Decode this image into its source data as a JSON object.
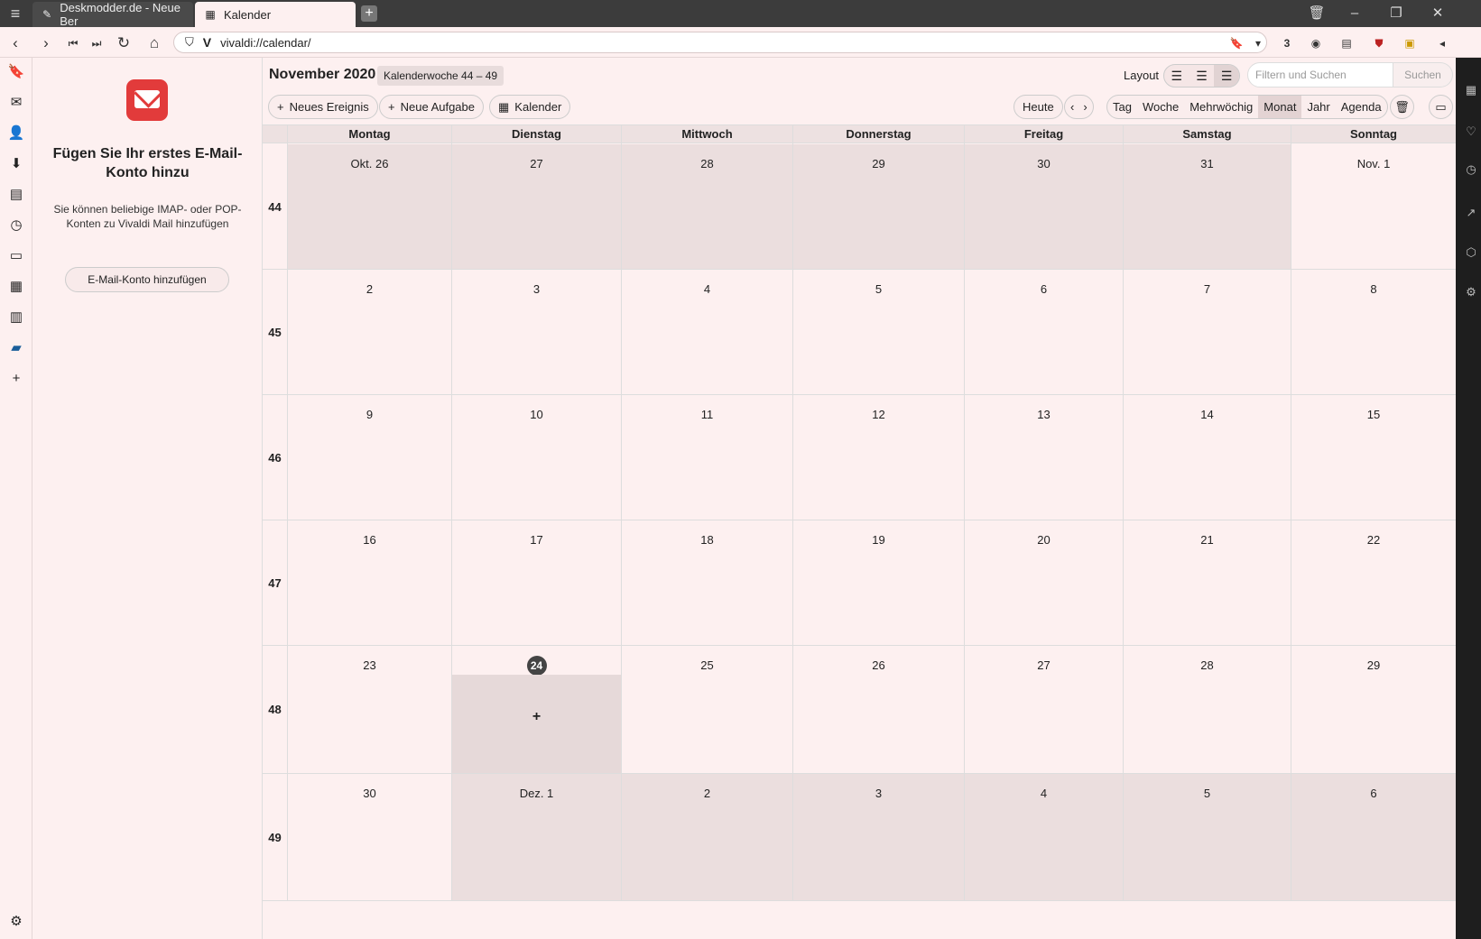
{
  "tabs": [
    {
      "label": "Deskmodder.de - Neue Ber",
      "icon": "pen-icon"
    },
    {
      "label": "Kalender",
      "icon": "calendar-icon"
    }
  ],
  "address": {
    "url": "vivaldi://calendar/"
  },
  "extension_badge": "3",
  "mail_panel": {
    "title": "Fügen Sie Ihr erstes E-Mail-Konto hinzu",
    "description": "Sie können beliebige IMAP- oder POP-Konten zu Vivaldi Mail hinzufügen",
    "button": "E-Mail-Konto hinzufügen"
  },
  "calendar": {
    "title": "November 2020",
    "week_range": "Kalenderwoche 44 – 49",
    "layout_label": "Layout",
    "search_placeholder": "Filtern und Suchen",
    "search_button": "Suchen",
    "new_event": "Neues Ereignis",
    "new_task": "Neue Aufgabe",
    "calendars": "Kalender",
    "today": "Heute",
    "views": [
      "Tag",
      "Woche",
      "Mehrwöchig",
      "Monat",
      "Jahr",
      "Agenda"
    ],
    "selected_view": "Monat",
    "day_names": [
      "Montag",
      "Dienstag",
      "Mittwoch",
      "Donnerstag",
      "Freitag",
      "Samstag",
      "Sonntag"
    ],
    "weeks": [
      {
        "num": "44",
        "days": [
          "Okt. 26",
          "27",
          "28",
          "29",
          "30",
          "31",
          "Nov.  1"
        ]
      },
      {
        "num": "45",
        "days": [
          "2",
          "3",
          "4",
          "5",
          "6",
          "7",
          "8"
        ]
      },
      {
        "num": "46",
        "days": [
          "9",
          "10",
          "11",
          "12",
          "13",
          "14",
          "15"
        ]
      },
      {
        "num": "47",
        "days": [
          "16",
          "17",
          "18",
          "19",
          "20",
          "21",
          "22"
        ]
      },
      {
        "num": "48",
        "days": [
          "23",
          "24",
          "25",
          "26",
          "27",
          "28",
          "29"
        ]
      },
      {
        "num": "49",
        "days": [
          "30",
          "Dez.  1",
          "2",
          "3",
          "4",
          "5",
          "6"
        ]
      }
    ],
    "today_date": "24",
    "add_symbol": "+"
  }
}
